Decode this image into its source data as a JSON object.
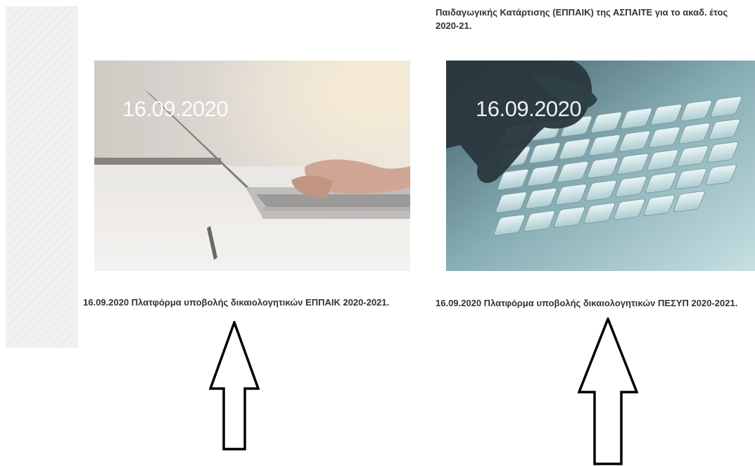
{
  "top_snippet": "Παιδαγωγικής Κατάρτισης (ΕΠΠΑΙΚ) της ΑΣΠΑΙΤΕ για το ακαδ. έτος 2020-21.",
  "cards": [
    {
      "date_overlay": "16.09.2020",
      "caption": "16.09.2020 Πλατφόρμα υποβολής δικαιολογητικών ΕΠΠΑΙΚ 2020-2021."
    },
    {
      "date_overlay": "16.09.2020",
      "caption": "16.09.2020 Πλατφόρμα υποβολής δικαιολογητικών ΠΕΣΥΠ 2020-2021."
    }
  ]
}
